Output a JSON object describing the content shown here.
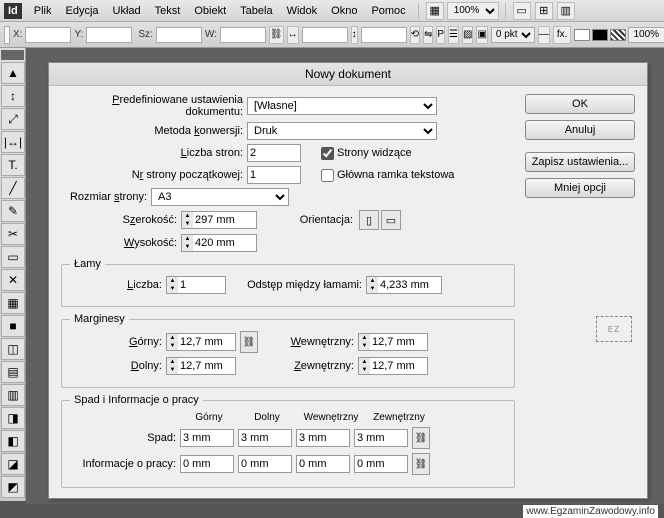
{
  "app": {
    "id": "Id"
  },
  "menu": {
    "items": [
      "Plik",
      "Edycja",
      "Układ",
      "Tekst",
      "Obiekt",
      "Tabela",
      "Widok",
      "Okno",
      "Pomoc"
    ],
    "zoom": "100%"
  },
  "optbar": {
    "x": "",
    "y": "",
    "sz": "",
    "w": "",
    "stroke": "0 pkt",
    "stroke_pct": "100%",
    "fx": "fx."
  },
  "tools": [
    "▲",
    "↕",
    "⤢",
    "|↔|",
    "T.",
    "╱",
    "✎",
    "✂",
    "▭",
    "✕",
    "▦",
    "■",
    "◫",
    "▤",
    "▥",
    "◨",
    "◧",
    "◪",
    "◩"
  ],
  "dialog": {
    "title": "Nowy dokument",
    "preset_label": "Predefiniowane ustawienia dokumentu:",
    "preset_value": "[Własne]",
    "intent_label": "Metoda konwersji:",
    "intent_value": "Druk",
    "pages_label": "Liczba stron:",
    "pages_value": "2",
    "facing_label": "Strony widzące",
    "start_label": "Nr strony początkowej:",
    "start_value": "1",
    "primary_label": "Główna ramka tekstowa",
    "pagesize_label": "Rozmiar strony:",
    "pagesize_value": "A3",
    "width_label": "Szerokość:",
    "width_value": "297 mm",
    "height_label": "Wysokość:",
    "height_value": "420 mm",
    "orient_label": "Orientacja:",
    "columns": {
      "legend": "Łamy",
      "count_label": "Liczba:",
      "count_value": "1",
      "gutter_label": "Odstęp między łamami:",
      "gutter_value": "4,233 mm"
    },
    "margins": {
      "legend": "Marginesy",
      "top_label": "Górny:",
      "top_value": "12,7 mm",
      "bottom_label": "Dolny:",
      "bottom_value": "12,7 mm",
      "inside_label": "Wewnętrzny:",
      "inside_value": "12,7 mm",
      "outside_label": "Zewnętrzny:",
      "outside_value": "12,7 mm"
    },
    "bleed": {
      "legend": "Spad i Informacje o pracy",
      "col_top": "Górny",
      "col_bottom": "Dolny",
      "col_inside": "Wewnętrzny",
      "col_outside": "Zewnętrzny",
      "spad_label": "Spad:",
      "spad": {
        "top": "3 mm",
        "bottom": "3 mm",
        "inside": "3 mm",
        "outside": "3 mm"
      },
      "slug_label": "Informacje o pracy:",
      "slug": {
        "top": "0 mm",
        "bottom": "0 mm",
        "inside": "0 mm",
        "outside": "0 mm"
      }
    },
    "buttons": {
      "ok": "OK",
      "cancel": "Anuluj",
      "save": "Zapisz ustawienia...",
      "less": "Mniej opcji"
    }
  },
  "footer": "www.EgzaminZawodowy.info",
  "watermark": "EZ"
}
